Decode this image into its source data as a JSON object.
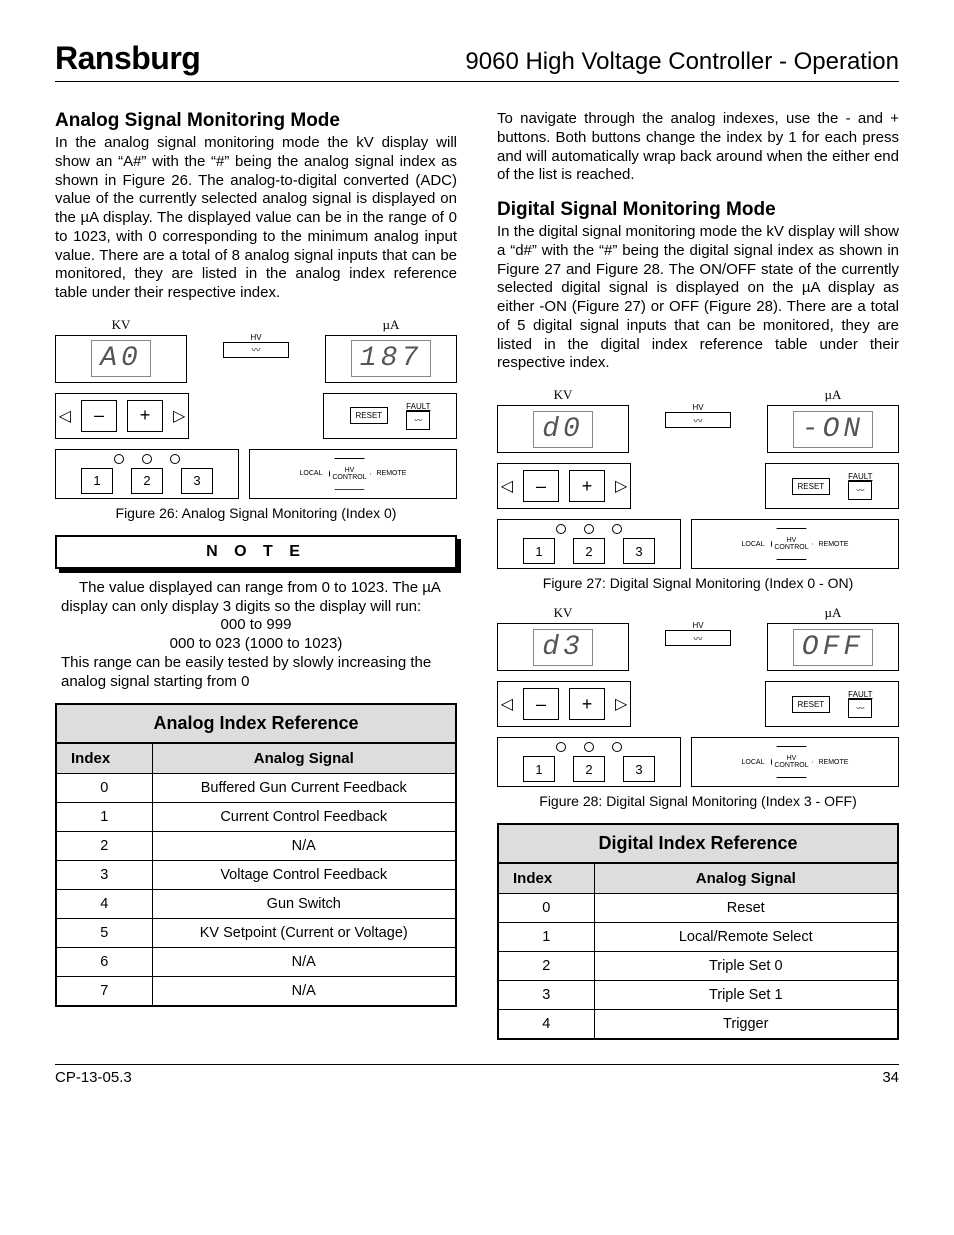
{
  "header": {
    "brand": "Ransburg",
    "doc_title": "9060 High Voltage Controller - Operation"
  },
  "left": {
    "h_analog": "Analog Signal Monitoring Mode",
    "p_analog": "In the analog signal monitoring mode the kV display will show an “A#” with the “#” being the analog signal index as shown in Figure 26.  The analog-to-digital converted (ADC) value of the currently selected analog signal is displayed on the µA display.  The displayed value can be in the range of 0 to 1023, with 0 corresponding to the minimum analog input value.  There are a total of 8 analog signal inputs that can be monitored, they are listed in the analog index reference table under their respective index.",
    "fig26": {
      "kv_label": "KV",
      "ua_label": "µA",
      "kv_value": "A0",
      "ua_value": "187",
      "caption": "Figure 26: Analog Signal Monitoring (Index 0)"
    },
    "note_title": "N O T E",
    "note_p1": "The value displayed can range from 0 to 1023.  The µA display can only display 3 digits so the display will run:",
    "note_line1": "000 to 999",
    "note_line2": "000 to 023 (1000 to 1023)",
    "note_p2": "This range can be easily tested by slowly increasing the analog signal starting from 0",
    "analog_table": {
      "title": "Analog Index Reference",
      "col1": "Index",
      "col2": "Analog Signal",
      "rows": [
        {
          "idx": "0",
          "sig": "Buffered Gun Current Feedback"
        },
        {
          "idx": "1",
          "sig": "Current Control Feedback"
        },
        {
          "idx": "2",
          "sig": "N/A"
        },
        {
          "idx": "3",
          "sig": "Voltage Control Feedback"
        },
        {
          "idx": "4",
          "sig": "Gun Switch"
        },
        {
          "idx": "5",
          "sig": "KV Setpoint (Current or Voltage)"
        },
        {
          "idx": "6",
          "sig": "N/A"
        },
        {
          "idx": "7",
          "sig": "N/A"
        }
      ]
    }
  },
  "right": {
    "p_nav": "To navigate through the analog indexes, use the - and + buttons.  Both buttons change the index by 1 for each press and will automatically wrap back around when the either end of the list is reached.",
    "h_digital": "Digital Signal Monitoring Mode",
    "p_digital": "In the digital signal monitoring mode the kV display will show a “d#” with the “#” being the digital signal index as shown in Figure 27 and Figure 28.  The ON/OFF state of the currently selected digital signal is displayed on the µA display as either -ON (Figure 27) or OFF (Figure 28).   There are a total of 5 digital signal inputs that can be monitored, they are listed in the digital index reference table under their respective index.",
    "fig27": {
      "kv_label": "KV",
      "ua_label": "µA",
      "kv_value": "d0",
      "ua_value": "-ON",
      "caption": "Figure 27: Digital Signal Monitoring (Index 0 - ON)"
    },
    "fig28": {
      "kv_label": "KV",
      "ua_label": "µA",
      "kv_value": "d3",
      "ua_value": "OFF",
      "caption": "Figure 28: Digital Signal Monitoring (Index 3 - OFF)"
    },
    "digital_table": {
      "title": "Digital Index Reference",
      "col1": "Index",
      "col2": "Analog Signal",
      "rows": [
        {
          "idx": "0",
          "sig": "Reset"
        },
        {
          "idx": "1",
          "sig": "Local/Remote Select"
        },
        {
          "idx": "2",
          "sig": "Triple Set 0"
        },
        {
          "idx": "3",
          "sig": "Triple Set 1"
        },
        {
          "idx": "4",
          "sig": "Trigger"
        }
      ]
    }
  },
  "panel_labels": {
    "hv": "HV",
    "reset": "RESET",
    "fault": "FAULT",
    "minus": "–",
    "plus": "+",
    "one": "1",
    "two": "2",
    "three": "3",
    "local": "LOCAL",
    "hv_control": "HV CONTROL",
    "remote": "REMOTE"
  },
  "footer": {
    "left": "CP-13-05.3",
    "right": "34"
  }
}
